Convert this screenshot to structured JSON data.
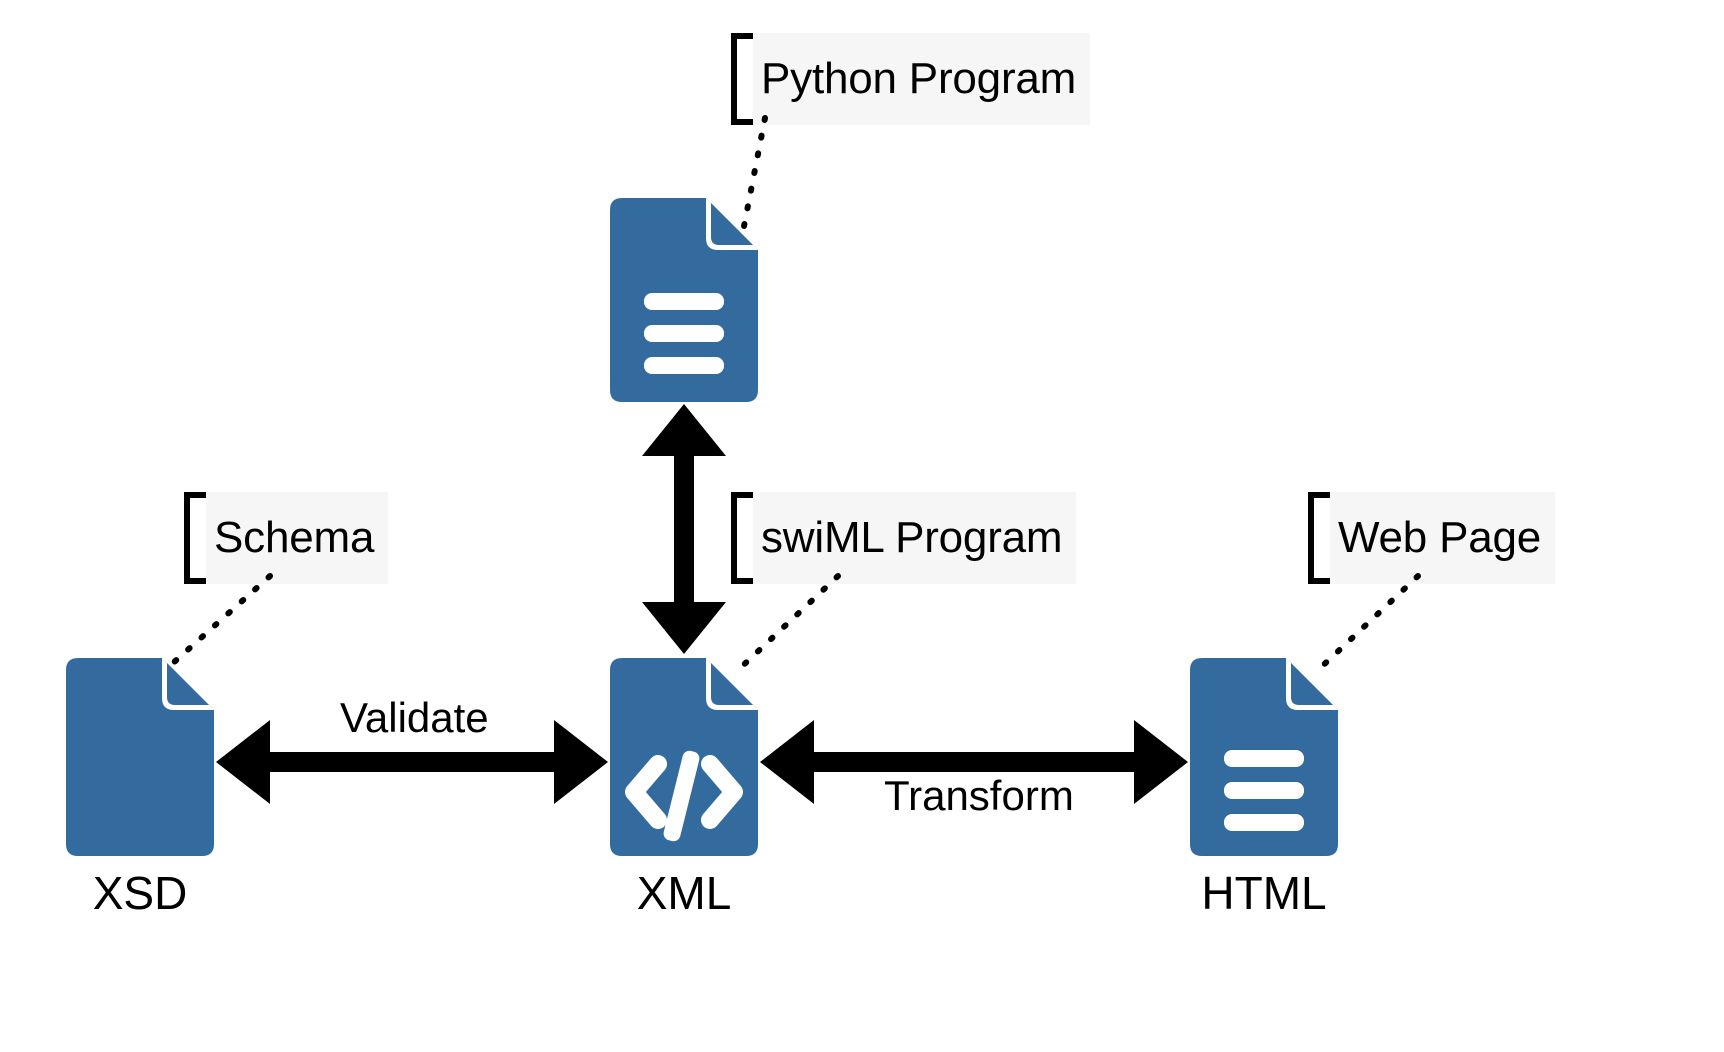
{
  "diagram": {
    "title": "XML toolchain diagram",
    "background_color": "#ffffff",
    "icon_color": "#336b9e",
    "accent_color": "#000000",
    "callout_background": "#f6f6f6"
  },
  "nodes": [
    {
      "id": "python",
      "icon": "document-lines-icon",
      "label": "",
      "callout": "Python Program"
    },
    {
      "id": "xsd",
      "icon": "document-blank-icon",
      "label": "XSD",
      "callout": "Schema"
    },
    {
      "id": "xml",
      "icon": "document-code-icon",
      "label": "XML",
      "callout": "swiML Program"
    },
    {
      "id": "html",
      "icon": "document-lines-icon",
      "label": "HTML",
      "callout": "Web Page"
    }
  ],
  "callouts": {
    "python": "Python Program",
    "schema": "Schema",
    "swiml": "swiML Program",
    "webpage": "Web Page"
  },
  "node_labels": {
    "xsd": "XSD",
    "xml": "XML",
    "html": "HTML"
  },
  "edges": [
    {
      "id": "validate",
      "from": "XSD",
      "to": "XML",
      "label": "Validate",
      "direction": "bidirectional"
    },
    {
      "id": "transform",
      "from": "HTML",
      "to": "XML",
      "label": "Transform",
      "direction": "bidirectional"
    },
    {
      "id": "generate",
      "from": "XML",
      "to": "Python Program",
      "label": "",
      "direction": "bidirectional"
    }
  ],
  "edge_labels": {
    "validate": "Validate",
    "transform": "Transform"
  }
}
